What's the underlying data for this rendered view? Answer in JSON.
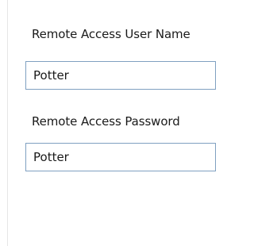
{
  "remote_access": {
    "user_name": {
      "label": "Remote Access User Name",
      "value": "Potter"
    },
    "password": {
      "label": "Remote Access Password",
      "value": "Potter"
    }
  },
  "colors": {
    "input_border": "#7fa0c1",
    "text": "#1a1a1a",
    "background": "#ffffff"
  }
}
